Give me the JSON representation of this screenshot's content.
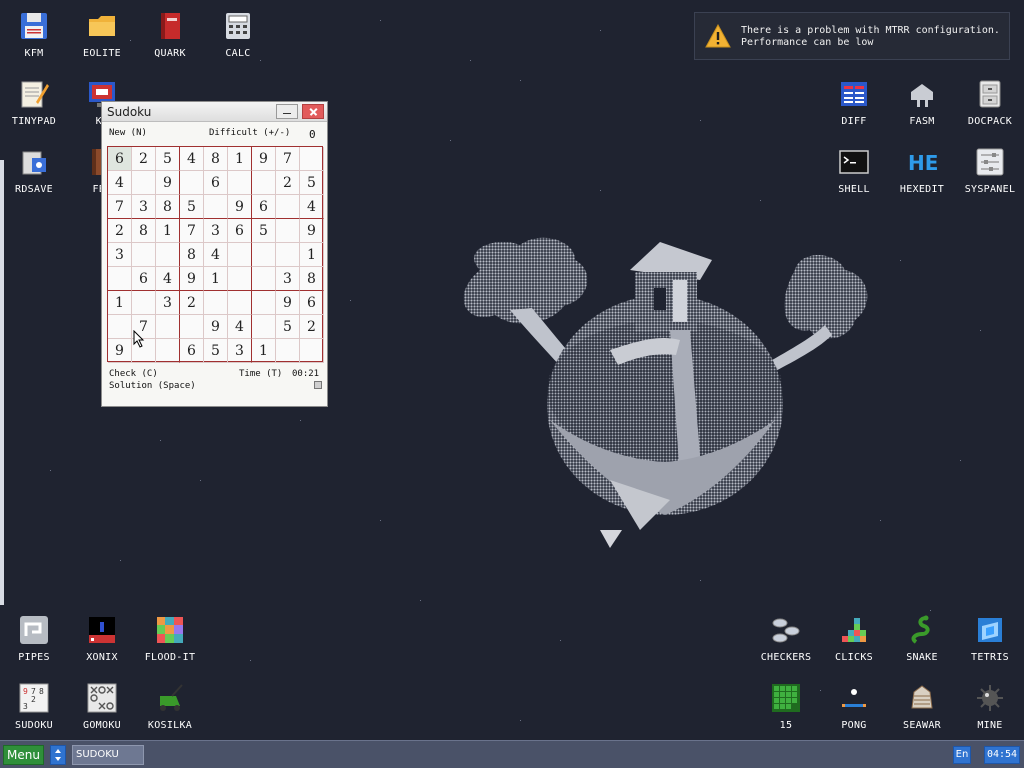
{
  "desktop": {
    "icons": [
      {
        "label": "KFM",
        "icon": "floppy-disk-icon"
      },
      {
        "label": "EOLITE",
        "icon": "folder-icon"
      },
      {
        "label": "QUARK",
        "icon": "red-book-icon"
      },
      {
        "label": "CALC",
        "icon": "calculator-icon"
      },
      {
        "label": "TINYPAD",
        "icon": "notepad-pencil-icon"
      },
      {
        "label": "KF",
        "icon": "monitor-icon"
      },
      {
        "label": "RDSAVE",
        "icon": "disk-save-icon"
      },
      {
        "label": "FB2",
        "icon": "brown-book-icon"
      },
      {
        "label": "DIFF",
        "icon": "diff-table-icon"
      },
      {
        "label": "FASM",
        "icon": "fasm-assembler-icon"
      },
      {
        "label": "DOCPACK",
        "icon": "cabinet-icon"
      },
      {
        "label": "SHELL",
        "icon": "terminal-icon"
      },
      {
        "label": "HEXEDIT",
        "icon": "hex-editor-icon"
      },
      {
        "label": "SYSPANEL",
        "icon": "sliders-panel-icon"
      },
      {
        "label": "PIPES",
        "icon": "pipes-game-icon"
      },
      {
        "label": "XONIX",
        "icon": "xonix-game-icon"
      },
      {
        "label": "FLOOD-IT",
        "icon": "flood-it-game-icon"
      },
      {
        "label": "SUDOKU",
        "icon": "sudoku-game-icon"
      },
      {
        "label": "GOMOKU",
        "icon": "gomoku-game-icon"
      },
      {
        "label": "KOSILKA",
        "icon": "lawn-mower-icon"
      },
      {
        "label": "CHECKERS",
        "icon": "checkers-game-icon"
      },
      {
        "label": "CLICKS",
        "icon": "clicks-game-icon"
      },
      {
        "label": "SNAKE",
        "icon": "snake-game-icon"
      },
      {
        "label": "TETRIS",
        "icon": "tetris-game-icon"
      },
      {
        "label": "15",
        "icon": "fifteen-puzzle-icon"
      },
      {
        "label": "PONG",
        "icon": "pong-game-icon"
      },
      {
        "label": "SEAWAR",
        "icon": "seawar-game-icon"
      },
      {
        "label": "MINE",
        "icon": "minesweeper-icon"
      }
    ]
  },
  "notification": {
    "icon": "warning-icon",
    "line1": "There is a problem with MTRR configuration.",
    "line2": "Performance can be low"
  },
  "sudoku": {
    "title": "Sudoku",
    "new_label": "New (N)",
    "difficulty_label": "Difficult (+/-)",
    "difficulty_value": "0",
    "check_label": "Check (C)",
    "time_label": "Time (T)",
    "time_value": "00:21",
    "solution_label": "Solution (Space)",
    "grid": [
      [
        "6",
        "2",
        "5",
        "4",
        "8",
        "1",
        "9",
        "7",
        ""
      ],
      [
        "4",
        "",
        "9",
        "",
        "6",
        "",
        "",
        "2",
        "5"
      ],
      [
        "7",
        "3",
        "8",
        "5",
        "",
        "9",
        "6",
        "",
        "4"
      ],
      [
        "2",
        "8",
        "1",
        "7",
        "3",
        "6",
        "5",
        "",
        "9"
      ],
      [
        "3",
        "",
        "",
        "8",
        "4",
        "",
        "",
        "",
        "1"
      ],
      [
        "",
        "6",
        "4",
        "9",
        "1",
        "",
        "",
        "3",
        "8"
      ],
      [
        "1",
        "",
        "3",
        "2",
        "",
        "",
        "",
        "9",
        "6"
      ],
      [
        "",
        "7",
        "",
        "",
        "9",
        "4",
        "",
        "5",
        "2"
      ],
      [
        "9",
        "",
        "",
        "6",
        "5",
        "3",
        "1",
        "",
        ""
      ]
    ]
  },
  "taskbar": {
    "menu_label": "Menu",
    "task_label": "SUDOKU",
    "lang": "En",
    "clock": "04:54"
  }
}
